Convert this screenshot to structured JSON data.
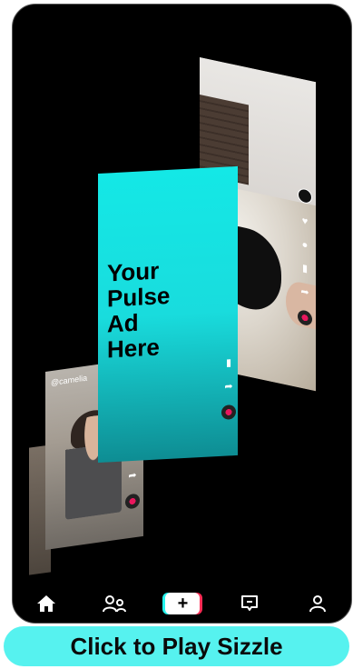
{
  "ad_card": {
    "lines": [
      "Your",
      "Pulse",
      "Ad",
      "Here"
    ]
  },
  "camelia_card": {
    "handle": "@camelia"
  },
  "nav": {
    "items": [
      {
        "icon": "home-icon"
      },
      {
        "icon": "friends-icon"
      },
      {
        "icon": "create-icon",
        "label": "+"
      },
      {
        "icon": "inbox-icon"
      },
      {
        "icon": "profile-icon"
      }
    ]
  },
  "cta": {
    "label": "Click to Play Sizzle"
  },
  "colors": {
    "accent_cyan": "#25f4ee",
    "accent_red": "#fe2c55",
    "cta_bg": "#56f2ef",
    "ad_gradient_top": "#14e8e6",
    "ad_gradient_bottom": "#0e8d93"
  }
}
